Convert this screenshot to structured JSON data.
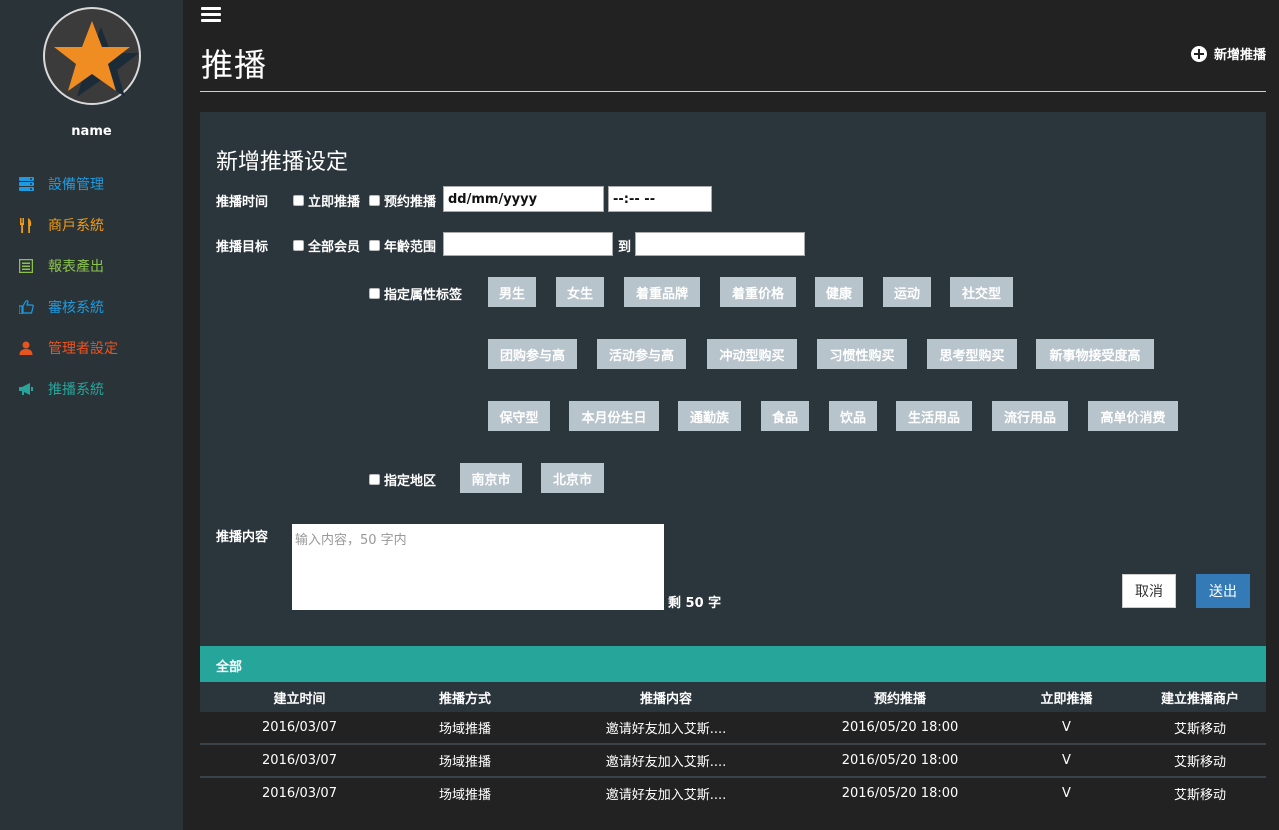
{
  "sidebar": {
    "username": "name",
    "items": [
      {
        "label": "設備管理",
        "color": "#1e9be0",
        "icon": "server-icon"
      },
      {
        "label": "商戶系統",
        "color": "#f39c12",
        "icon": "cutlery-icon"
      },
      {
        "label": "報表產出",
        "color": "#8bc34a",
        "icon": "list-icon"
      },
      {
        "label": "審核系統",
        "color": "#1e9be0",
        "icon": "thumbs-up-icon"
      },
      {
        "label": "管理者設定",
        "color": "#e8541e",
        "icon": "user-icon"
      },
      {
        "label": "推播系統",
        "color": "#26a69a",
        "icon": "bullhorn-icon"
      }
    ]
  },
  "header": {
    "title": "推播",
    "add_label": "新增推播"
  },
  "form": {
    "title": "新增推播设定",
    "time_label": "推播时间",
    "immediate_label": "立即推播",
    "scheduled_label": "预约推播",
    "date_value": "dd/mm/yyyy",
    "time_value": "--:-- --",
    "target_label": "推播目标",
    "all_members_label": "全部会员",
    "age_range_label": "年齡范围",
    "to_label": "到",
    "tags_label": "指定属性标签",
    "tags": [
      "男生",
      "女生",
      "着重品牌",
      "着重价格",
      "健康",
      "运动",
      "社交型",
      "团购参与高",
      "活动参与高",
      "冲动型购买",
      "习惯性购买",
      "思考型购买",
      "新事物接受度高",
      "保守型",
      "本月份生日",
      "通勤族",
      "食品",
      "饮品",
      "生活用品",
      "流行用品",
      "高单价消费"
    ],
    "region_label": "指定地区",
    "regions": [
      "南京市",
      "北京市"
    ],
    "content_label": "推播内容",
    "content_placeholder": "输入内容，50 字内",
    "remaining": "剩 50 字",
    "cancel_label": "取消",
    "submit_label": "送出"
  },
  "table": {
    "section_label": "全部",
    "columns": [
      "建立时间",
      "推播方式",
      "推播内容",
      "预约推播",
      "立即推播",
      "建立推播商户"
    ],
    "rows": [
      [
        "2016/03/07",
        "场域推播",
        "邀请好友加入艾斯....",
        "2016/05/20 18:00",
        "V",
        "艾斯移动"
      ],
      [
        "2016/03/07",
        "场域推播",
        "邀请好友加入艾斯....",
        "2016/05/20 18:00",
        "V",
        "艾斯移动"
      ],
      [
        "2016/03/07",
        "场域推播",
        "邀请好友加入艾斯....",
        "2016/05/20 18:00",
        "V",
        "艾斯移动"
      ]
    ]
  }
}
